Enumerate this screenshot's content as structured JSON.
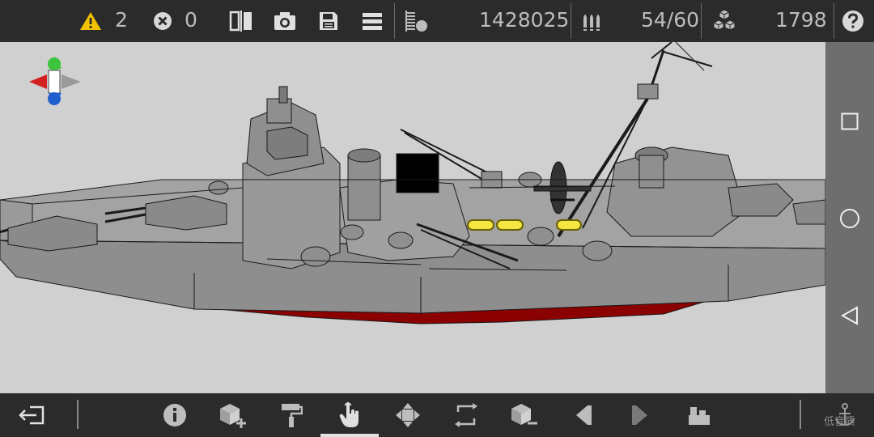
{
  "topbar": {
    "warning_count": "2",
    "error_count": "0",
    "part_count": "1428025",
    "ammo": "54/60",
    "blocks": "1798"
  },
  "watermark": "低音质",
  "colors": {
    "bar_bg": "#2b2b2b",
    "warning": "#f2c200",
    "hull_red": "#8b0000",
    "hull_gray": "#8e8e8e",
    "highlight": "#f5e642"
  },
  "icons": {
    "warning": "warning-icon",
    "error": "error-icon",
    "symmetry": "mirror-icon",
    "camera": "camera-icon",
    "save": "save-icon",
    "menu": "menu-icon",
    "stats": "stats-icon",
    "ammo": "ammo-icon",
    "blocks": "blocks-icon",
    "help": "help-icon"
  }
}
